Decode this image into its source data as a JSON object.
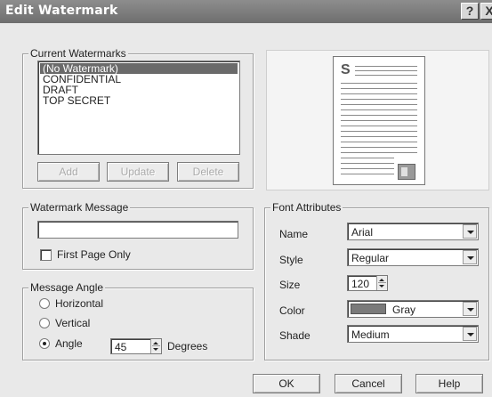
{
  "window": {
    "title": "Edit Watermark",
    "help_glyph": "?",
    "close_glyph": "X"
  },
  "current_watermarks": {
    "label": "Current Watermarks",
    "items": [
      "(No Watermark)",
      "CONFIDENTIAL",
      "DRAFT",
      "TOP SECRET"
    ],
    "selected": "(No Watermark)",
    "add_label": "Add",
    "update_label": "Update",
    "delete_label": "Delete"
  },
  "preview": {
    "page_letter": "S"
  },
  "watermark_message": {
    "label": "Watermark Message",
    "value": "",
    "first_page_only_label": "First Page Only",
    "first_page_only_checked": false
  },
  "message_angle": {
    "label": "Message Angle",
    "horizontal_label": "Horizontal",
    "vertical_label": "Vertical",
    "angle_label": "Angle",
    "angle_value": "45",
    "degrees_label": "Degrees",
    "selected": "Angle"
  },
  "font_attributes": {
    "label": "Font Attributes",
    "name_label": "Name",
    "name_value": "Arial",
    "style_label": "Style",
    "style_value": "Regular",
    "size_label": "Size",
    "size_value": "120",
    "color_label": "Color",
    "color_value": "Gray",
    "color_hex": "#7a7a7a",
    "shade_label": "Shade",
    "shade_value": "Medium"
  },
  "footer": {
    "ok_label": "OK",
    "cancel_label": "Cancel",
    "help_label": "Help"
  }
}
